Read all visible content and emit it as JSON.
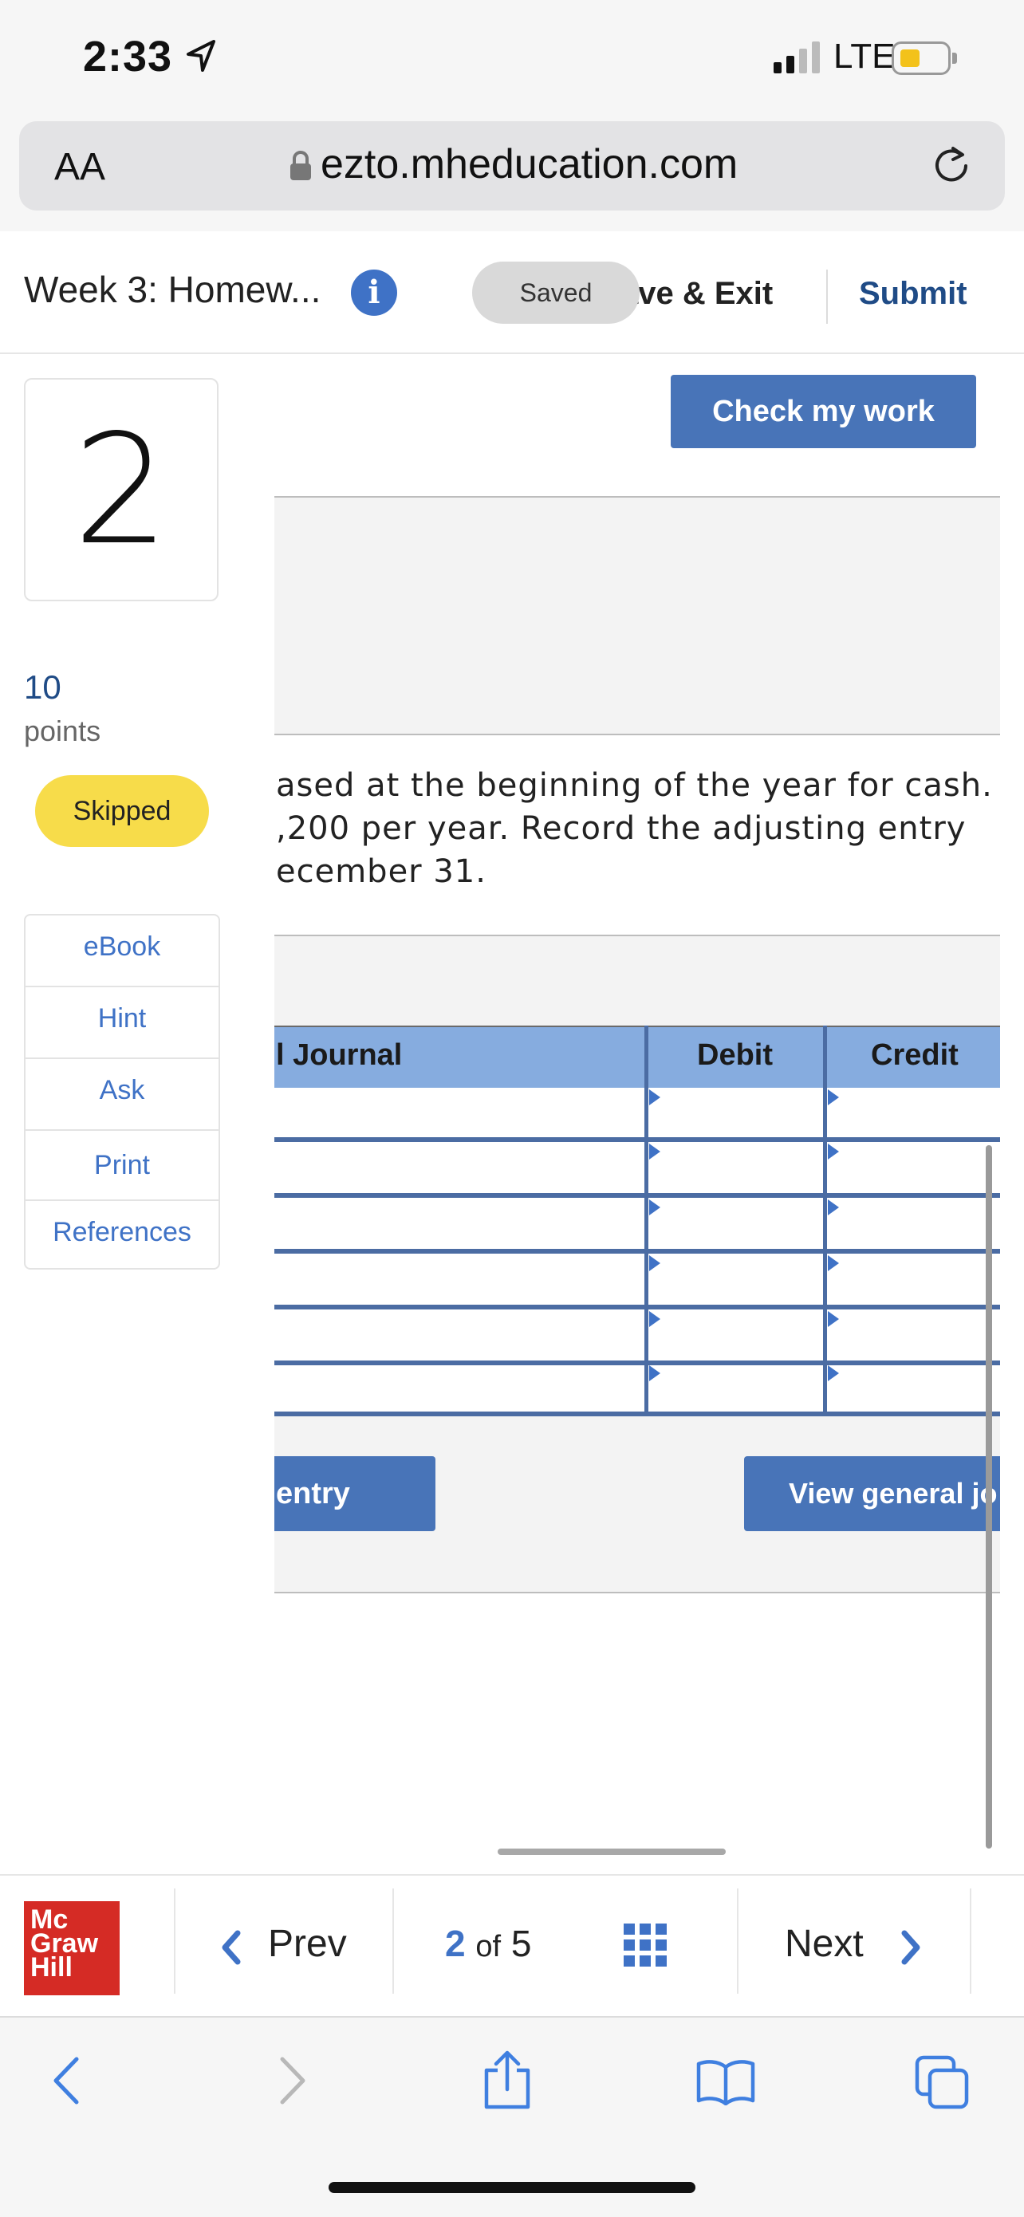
{
  "status_bar": {
    "time": "2:33",
    "network": "LTE"
  },
  "browser": {
    "text_size_button": "AA",
    "url": "ezto.mheducation.com"
  },
  "header": {
    "title": "Week 3: Homew...",
    "saved_badge": "Saved",
    "save_exit": "ave & Exit",
    "submit": "Submit"
  },
  "question": {
    "number": "2",
    "points_value": "10",
    "points_label": "points",
    "status": "Skipped",
    "check_button": "Check my work",
    "text_lines": [
      "ased at the beginning of the year for cash.",
      ",200 per year. Record the adjusting entry",
      "ecember 31."
    ]
  },
  "tools": [
    "eBook",
    "Hint",
    "Ask",
    "Print",
    "References"
  ],
  "journal": {
    "headers": {
      "journal": "l Journal",
      "debit": "Debit",
      "credit": "Credit"
    },
    "rows": 6,
    "entry_button": "entry",
    "view_button": "View general jo"
  },
  "footer": {
    "logo": [
      "Mc",
      "Graw",
      "Hill"
    ],
    "prev": "Prev",
    "current_page": "2",
    "of_label": "of",
    "total_pages": "5",
    "next": "Next"
  },
  "colors": {
    "accent": "#3f72c6",
    "button": "#4874b8",
    "skipped": "#f7dc4a",
    "table_header": "#86acdf",
    "logo": "#d52b25"
  }
}
